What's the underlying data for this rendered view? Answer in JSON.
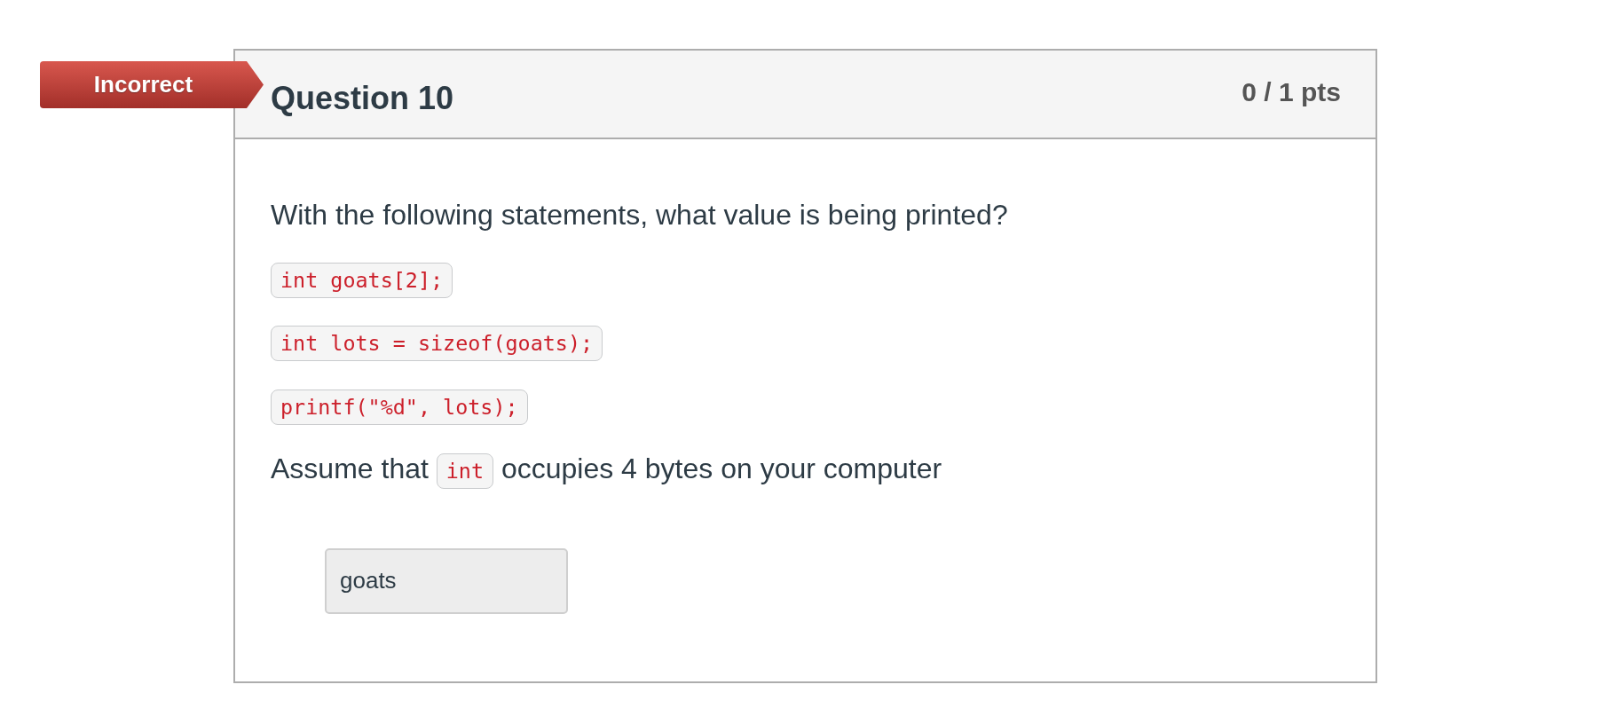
{
  "badge": {
    "label": "Incorrect",
    "correct": false
  },
  "question": {
    "title": "Question 10",
    "points": "0 / 1 pts"
  },
  "prompt": "With the following statements, what value is being printed?",
  "code_lines": [
    "int goats[2];",
    "int lots = sizeof(goats);",
    "printf(\"%d\", lots);"
  ],
  "note": [
    {
      "kind": "text",
      "text": "Assume that"
    },
    {
      "kind": "code",
      "text": "int"
    },
    {
      "kind": "text",
      "text": "occupies 4 bytes on your computer"
    }
  ],
  "answer": {
    "value": "goats",
    "disabled": true
  }
}
